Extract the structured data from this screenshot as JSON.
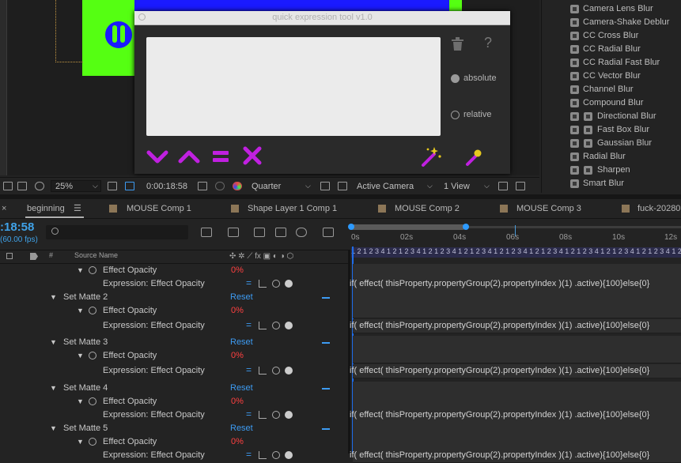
{
  "dialog": {
    "title": "quick expression tool v1.0",
    "radio_absolute": "absolute",
    "radio_relative": "relative",
    "help": "?"
  },
  "effects_list": [
    {
      "label": "Camera Lens Blur",
      "badge": false
    },
    {
      "label": "Camera-Shake Deblur",
      "badge": false
    },
    {
      "label": "CC Cross Blur",
      "badge": false
    },
    {
      "label": "CC Radial Blur",
      "badge": false
    },
    {
      "label": "CC Radial Fast Blur",
      "badge": false
    },
    {
      "label": "CC Vector Blur",
      "badge": false
    },
    {
      "label": "Channel Blur",
      "badge": false
    },
    {
      "label": "Compound Blur",
      "badge": false
    },
    {
      "label": "Directional Blur",
      "badge": true
    },
    {
      "label": "Fast Box Blur",
      "badge": true
    },
    {
      "label": "Gaussian Blur",
      "badge": true
    },
    {
      "label": "Radial Blur",
      "badge": false
    },
    {
      "label": "Sharpen",
      "badge": true
    },
    {
      "label": "Smart Blur",
      "badge": false
    }
  ],
  "viewer_toolbar": {
    "zoom": "25%",
    "timecode": "0:00:18:58",
    "resolution": "Quarter",
    "camera": "Active Camera",
    "views": "1 View"
  },
  "tabs": [
    {
      "label": "beginning",
      "active": true
    },
    {
      "label": "MOUSE Comp 1",
      "active": false
    },
    {
      "label": "Shape Layer 1 Comp 1",
      "active": false
    },
    {
      "label": "MOUSE Comp 2",
      "active": false
    },
    {
      "label": "MOUSE Comp 3",
      "active": false
    },
    {
      "label": "fuck-20280",
      "active": false
    }
  ],
  "timeline": {
    "timecode": ":18:58",
    "fps": "(60.00 fps)",
    "col_hash": "#",
    "col_source": "Source Name",
    "ruler_ticks": [
      "0s",
      "02s",
      "04s",
      "06s",
      "08s",
      "10s",
      "12s"
    ],
    "frame_strip": "1 2 1 2 3 4 1 2 1 2 3 4 1 2 1 2 3 4 1 2 1 2 3 4 1 2 1 2 3 4 1 2 1 2 3 4 1 2 1 2 3 4 1 2 1 2 3 4 1 2 1 2 3 4 1 2 1 2 3 4"
  },
  "layers": [
    {
      "type": "prop",
      "label": "Effect Opacity",
      "value": "0%"
    },
    {
      "type": "expr",
      "label": "Expression: Effect Opacity",
      "expression": "if(   effect(   thisProperty.propertyGroup(2).propertyIndex   )(1)   .active){100}else{0}"
    },
    {
      "type": "group",
      "label": "Set Matte 2",
      "reset": "Reset"
    },
    {
      "type": "prop",
      "label": "Effect Opacity",
      "value": "0%"
    },
    {
      "type": "expr",
      "label": "Expression: Effect Opacity",
      "expression": "if(   effect(   thisProperty.propertyGroup(2).propertyIndex   )(1)   .active){100}else{0}"
    },
    {
      "type": "group",
      "label": "Set Matte 3",
      "reset": "Reset"
    },
    {
      "type": "prop",
      "label": "Effect Opacity",
      "value": "0%"
    },
    {
      "type": "expr",
      "label": "Expression: Effect Opacity",
      "expression": "if(   effect(   thisProperty.propertyGroup(2).propertyIndex   )(1)   .active){100}else{0}"
    },
    {
      "type": "group",
      "label": "Set Matte 4",
      "reset": "Reset"
    },
    {
      "type": "prop",
      "label": "Effect Opacity",
      "value": "0%"
    },
    {
      "type": "expr",
      "label": "Expression: Effect Opacity",
      "expression": "if(   effect(   thisProperty.propertyGroup(2).propertyIndex   )(1)   .active){100}else{0}"
    },
    {
      "type": "group",
      "label": "Set Matte 5",
      "reset": "Reset"
    },
    {
      "type": "prop",
      "label": "Effect Opacity",
      "value": "0%"
    },
    {
      "type": "expr",
      "label": "Expression: Effect Opacity",
      "expression": "if(   effect(   thisProperty.propertyGroup(2).propertyIndex   )(1)   .active){100}else{0}"
    }
  ],
  "colors": {
    "accent_blue": "#3d9bf2",
    "value_red": "#ff4040",
    "dialog_purple": "#c020e0",
    "comp_blue": "#1a1aff",
    "comp_green": "#55ff12"
  }
}
